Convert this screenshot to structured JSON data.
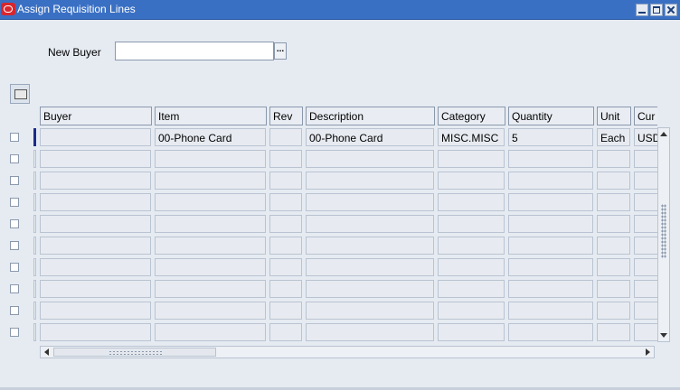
{
  "window": {
    "title": "Assign Requisition Lines"
  },
  "form": {
    "new_buyer_label": "New Buyer",
    "new_buyer_value": "",
    "lov_button_label": "..."
  },
  "table": {
    "columns": [
      "Buyer",
      "Item",
      "Rev",
      "Description",
      "Category",
      "Quantity",
      "Unit",
      "Cur"
    ],
    "rows": [
      [
        "",
        "00-Phone Card",
        "",
        "00-Phone Card",
        "MISC.MISC",
        "5",
        "Each",
        "USD"
      ],
      [
        "",
        "",
        "",
        "",
        "",
        "",
        "",
        ""
      ],
      [
        "",
        "",
        "",
        "",
        "",
        "",
        "",
        ""
      ],
      [
        "",
        "",
        "",
        "",
        "",
        "",
        "",
        ""
      ],
      [
        "",
        "",
        "",
        "",
        "",
        "",
        "",
        ""
      ],
      [
        "",
        "",
        "",
        "",
        "",
        "",
        "",
        ""
      ],
      [
        "",
        "",
        "",
        "",
        "",
        "",
        "",
        ""
      ],
      [
        "",
        "",
        "",
        "",
        "",
        "",
        "",
        ""
      ],
      [
        "",
        "",
        "",
        "",
        "",
        "",
        "",
        ""
      ],
      [
        "",
        "",
        "",
        "",
        "",
        "",
        "",
        ""
      ]
    ]
  },
  "colors": {
    "titlebar": "#3a70c4",
    "background": "#e6ebf2",
    "current_row_marker": "#1b2b8a"
  }
}
